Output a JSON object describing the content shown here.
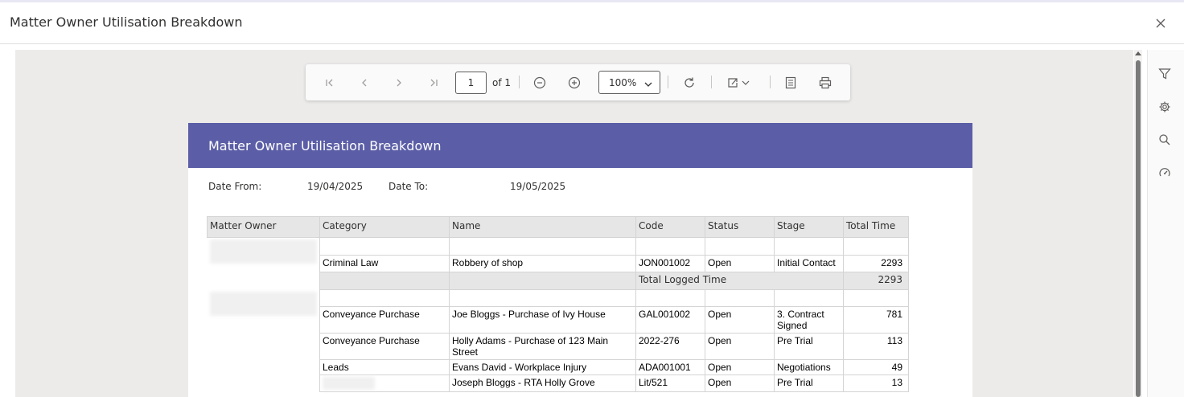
{
  "dialog": {
    "title": "Matter Owner Utilisation Breakdown"
  },
  "toolbar": {
    "page_value": "1",
    "page_of": "of 1",
    "zoom": "100%"
  },
  "report": {
    "title": "Matter Owner Utilisation Breakdown",
    "date_from_label": "Date From:",
    "date_from": "19/04/2025",
    "date_to_label": "Date To:",
    "date_to": "19/05/2025",
    "columns": [
      "Matter Owner",
      "Category",
      "Name",
      "Code",
      "Status",
      "Stage",
      "Total Time"
    ],
    "group1": {
      "row": {
        "category": "Criminal Law",
        "name": "Robbery of shop",
        "code": "JON001002",
        "status": "Open",
        "stage": "Initial Contact",
        "time": "2293"
      },
      "total_label": "Total Logged Time",
      "total_value": "2293"
    },
    "group2": {
      "rows": [
        {
          "category": "Conveyance Purchase",
          "name": "Joe Bloggs - Purchase of Ivy House",
          "code": "GAL001002",
          "status": "Open",
          "stage": "3. Contract Signed",
          "time": "781"
        },
        {
          "category": "Conveyance Purchase",
          "name": "Holly Adams - Purchase of 123 Main Street",
          "code": "2022-276",
          "status": "Open",
          "stage": "Pre Trial",
          "time": "113"
        },
        {
          "category": "Leads",
          "name": "Evans David - Workplace Injury",
          "code": "ADA001001",
          "status": "Open",
          "stage": "Negotiations",
          "time": "49"
        },
        {
          "category": "",
          "name": "Joseph Bloggs - RTA Holly Grove",
          "code": "Lit/521",
          "status": "Open",
          "stage": "Pre Trial",
          "time": "13"
        }
      ]
    }
  },
  "colors": {
    "banner": "#5b5ea6",
    "viewer_bg": "#ecebea"
  }
}
